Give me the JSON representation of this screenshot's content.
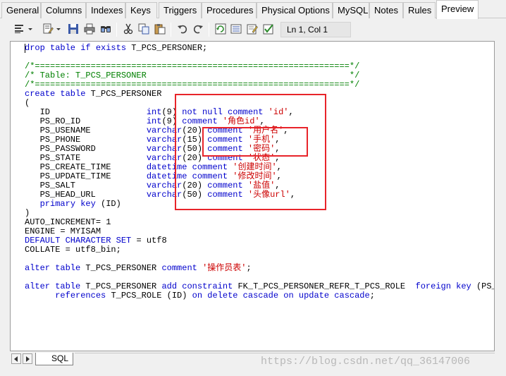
{
  "tabs": [
    {
      "label": "General",
      "active": false
    },
    {
      "label": "Columns",
      "active": false
    },
    {
      "label": "Indexes",
      "active": false
    },
    {
      "label": "Keys",
      "active": false
    },
    {
      "label": "Triggers",
      "active": false
    },
    {
      "label": "Procedures",
      "active": false
    },
    {
      "label": "Physical Options",
      "active": false
    },
    {
      "label": "MySQL",
      "active": false
    },
    {
      "label": "Notes",
      "active": false
    },
    {
      "label": "Rules",
      "active": false
    },
    {
      "label": "Preview",
      "active": true
    }
  ],
  "toolbar": {
    "icons": [
      "editor-menu-icon",
      "edit-with-icon",
      "save-icon",
      "print-icon",
      "find-icon",
      "cut-icon",
      "copy-icon",
      "paste-icon",
      "undo-icon",
      "redo-icon",
      "refresh-icon",
      "show-params-icon",
      "edit-icon",
      "check-icon"
    ],
    "cursor_position": "Ln 1, Col 1"
  },
  "code": {
    "lines": [
      [
        {
          "t": "drop table if exists ",
          "c": "kw"
        },
        {
          "t": "T_PCS_PERSONER;",
          "c": "tx"
        }
      ],
      [],
      [
        {
          "t": "/*==============================================================*/",
          "c": "cm"
        }
      ],
      [
        {
          "t": "/* Table: T_PCS_PERSONER                                        */",
          "c": "cm"
        }
      ],
      [
        {
          "t": "/*==============================================================*/",
          "c": "cm"
        }
      ],
      [
        {
          "t": "create table ",
          "c": "kw"
        },
        {
          "t": "T_PCS_PERSONER",
          "c": "tx"
        }
      ],
      [
        {
          "t": "(",
          "c": "tx"
        }
      ],
      [
        {
          "t": "   ID                   ",
          "c": "tx"
        },
        {
          "t": "int",
          "c": "kw"
        },
        {
          "t": "(9) ",
          "c": "tx"
        },
        {
          "t": "not null comment ",
          "c": "kw"
        },
        {
          "t": "'id'",
          "c": "str"
        },
        {
          "t": ",",
          "c": "tx"
        }
      ],
      [
        {
          "t": "   PS_RO_ID             ",
          "c": "tx"
        },
        {
          "t": "int",
          "c": "kw"
        },
        {
          "t": "(9) ",
          "c": "tx"
        },
        {
          "t": "comment ",
          "c": "kw"
        },
        {
          "t": "'角色id'",
          "c": "str"
        },
        {
          "t": ",",
          "c": "tx"
        }
      ],
      [
        {
          "t": "   PS_USENAME           ",
          "c": "tx"
        },
        {
          "t": "varchar",
          "c": "kw"
        },
        {
          "t": "(20) ",
          "c": "tx"
        },
        {
          "t": "comment ",
          "c": "kw"
        },
        {
          "t": "'用户名'",
          "c": "str"
        },
        {
          "t": ",",
          "c": "tx"
        }
      ],
      [
        {
          "t": "   PS_PHONE             ",
          "c": "tx"
        },
        {
          "t": "varchar",
          "c": "kw"
        },
        {
          "t": "(15) ",
          "c": "tx"
        },
        {
          "t": "comment ",
          "c": "kw"
        },
        {
          "t": "'手机'",
          "c": "str"
        },
        {
          "t": ",",
          "c": "tx"
        }
      ],
      [
        {
          "t": "   PS_PASSWORD          ",
          "c": "tx"
        },
        {
          "t": "varchar",
          "c": "kw"
        },
        {
          "t": "(50) ",
          "c": "tx"
        },
        {
          "t": "comment ",
          "c": "kw"
        },
        {
          "t": "'密码'",
          "c": "str"
        },
        {
          "t": ",",
          "c": "tx"
        }
      ],
      [
        {
          "t": "   PS_STATE             ",
          "c": "tx"
        },
        {
          "t": "varchar",
          "c": "kw"
        },
        {
          "t": "(20) ",
          "c": "tx"
        },
        {
          "t": "comment ",
          "c": "kw"
        },
        {
          "t": "'状态'",
          "c": "str"
        },
        {
          "t": ",",
          "c": "tx"
        }
      ],
      [
        {
          "t": "   PS_CREATE_TIME       ",
          "c": "tx"
        },
        {
          "t": "datetime comment ",
          "c": "kw"
        },
        {
          "t": "'创建时间'",
          "c": "str"
        },
        {
          "t": ",",
          "c": "tx"
        }
      ],
      [
        {
          "t": "   PS_UPDATE_TIME       ",
          "c": "tx"
        },
        {
          "t": "datetime comment ",
          "c": "kw"
        },
        {
          "t": "'修改时间'",
          "c": "str"
        },
        {
          "t": ",",
          "c": "tx"
        }
      ],
      [
        {
          "t": "   PS_SALT              ",
          "c": "tx"
        },
        {
          "t": "varchar",
          "c": "kw"
        },
        {
          "t": "(20) ",
          "c": "tx"
        },
        {
          "t": "comment ",
          "c": "kw"
        },
        {
          "t": "'盐值'",
          "c": "str"
        },
        {
          "t": ",",
          "c": "tx"
        }
      ],
      [
        {
          "t": "   PS_HEAD_URL          ",
          "c": "tx"
        },
        {
          "t": "varchar",
          "c": "kw"
        },
        {
          "t": "(50) ",
          "c": "tx"
        },
        {
          "t": "comment ",
          "c": "kw"
        },
        {
          "t": "'头像url'",
          "c": "str"
        },
        {
          "t": ",",
          "c": "tx"
        }
      ],
      [
        {
          "t": "   ",
          "c": "tx"
        },
        {
          "t": "primary key ",
          "c": "kw"
        },
        {
          "t": "(ID)",
          "c": "tx"
        }
      ],
      [
        {
          "t": ")",
          "c": "tx"
        }
      ],
      [
        {
          "t": "AUTO_INCREMENT= 1",
          "c": "tx"
        }
      ],
      [
        {
          "t": "ENGINE = MYISAM",
          "c": "tx"
        }
      ],
      [
        {
          "t": "DEFAULT CHARACTER SET ",
          "c": "kw"
        },
        {
          "t": "= utf8",
          "c": "tx"
        }
      ],
      [
        {
          "t": "COLLATE = utf8_bin;",
          "c": "tx"
        }
      ],
      [],
      [
        {
          "t": "alter table ",
          "c": "kw"
        },
        {
          "t": "T_PCS_PERSONER ",
          "c": "tx"
        },
        {
          "t": "comment ",
          "c": "kw"
        },
        {
          "t": "'操作员表'",
          "c": "str"
        },
        {
          "t": ";",
          "c": "tx"
        }
      ],
      [],
      [
        {
          "t": "alter table ",
          "c": "kw"
        },
        {
          "t": "T_PCS_PERSONER ",
          "c": "tx"
        },
        {
          "t": "add constraint ",
          "c": "kw"
        },
        {
          "t": "FK_T_PCS_PERSONER_REFR_T_PCS_ROLE  ",
          "c": "tx"
        },
        {
          "t": "foreign key ",
          "c": "kw"
        },
        {
          "t": "(PS_",
          "c": "tx"
        }
      ],
      [
        {
          "t": "      ",
          "c": "tx"
        },
        {
          "t": "references ",
          "c": "kw"
        },
        {
          "t": "T_PCS_ROLE (ID) ",
          "c": "tx"
        },
        {
          "t": "on delete cascade on update cascade",
          "c": "kw"
        },
        {
          "t": ";",
          "c": "tx"
        }
      ]
    ]
  },
  "bottom": {
    "sheet_tab": "SQL",
    "watermark": "https://blog.csdn.net/qq_36147006"
  },
  "colors": {
    "keyword": "#0000cc",
    "comment": "#008000",
    "string": "#cc0000",
    "annotation_box": "#e8242a"
  }
}
